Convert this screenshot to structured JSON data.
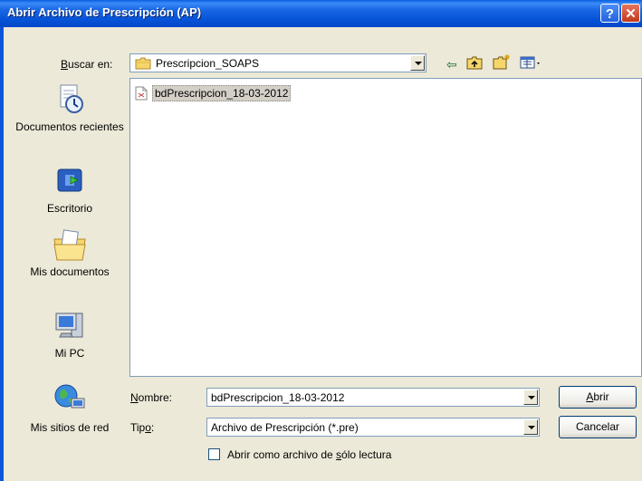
{
  "window": {
    "title": "Abrir Archivo de Prescripción (AP)",
    "help_glyph": "?",
    "close_glyph": "✕"
  },
  "lookin": {
    "label_ul": "B",
    "label_rest": "uscar en:",
    "value": "Prescripcion_SOAPS"
  },
  "toolbar": {
    "back_glyph": "⇦",
    "up_glyph": "⇧",
    "newfolder_glyph": "✱",
    "views_glyph": "▦▾"
  },
  "places": [
    {
      "label": "Documentos recientes",
      "icon": "recent-documents-icon"
    },
    {
      "label": "Escritorio",
      "icon": "desktop-icon"
    },
    {
      "label": "Mis documentos",
      "icon": "my-documents-icon"
    },
    {
      "label": "Mi PC",
      "icon": "my-computer-icon"
    },
    {
      "label": "Mis sitios de red",
      "icon": "network-places-icon"
    }
  ],
  "files": [
    {
      "name": "bdPrescripcion_18-03-2012"
    }
  ],
  "filename": {
    "label_ul": "N",
    "label_rest": "ombre:",
    "value": "bdPrescripcion_18-03-2012"
  },
  "filetype": {
    "label_pre": "Tip",
    "label_ul": "o",
    "label_post": ":",
    "value": "Archivo de Prescripción (*.pre)"
  },
  "buttons": {
    "open_ul": "A",
    "open_rest": "brir",
    "cancel": "Cancelar"
  },
  "readonly": {
    "pre": "Abrir como archivo de ",
    "ul": "s",
    "post": "ólo lectura",
    "checked": false
  },
  "colors": {
    "title_bar": "#0A5FE0",
    "dialog_bg": "#ECE9D8",
    "selection": "#D4D0C8"
  }
}
